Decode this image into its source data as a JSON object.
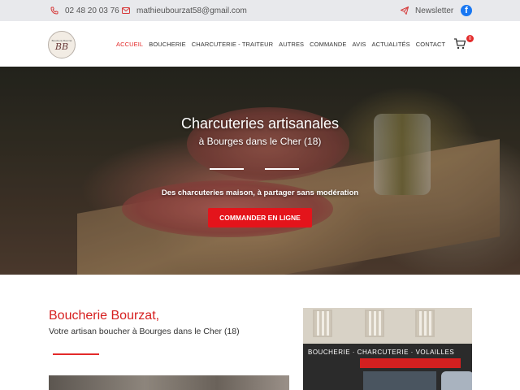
{
  "topbar": {
    "phone": "02 48 20 03 76",
    "email": "mathieubourzat58@gmail.com",
    "newsletter": "Newsletter",
    "facebook_icon": "facebook-icon"
  },
  "header": {
    "logo_text": "BB",
    "logo_caption": "Boucherie Bourzat",
    "nav": [
      {
        "label": "ACCUEIL",
        "active": true
      },
      {
        "label": "BOUCHERIE",
        "active": false
      },
      {
        "label": "CHARCUTERIE - TRAITEUR",
        "active": false
      },
      {
        "label": "AUTRES",
        "active": false
      },
      {
        "label": "COMMANDE",
        "active": false
      },
      {
        "label": "AVIS",
        "active": false
      },
      {
        "label": "ACTUALITÉS",
        "active": false
      },
      {
        "label": "CONTACT",
        "active": false
      }
    ],
    "cart_count": "0"
  },
  "hero": {
    "title": "Charcuteries artisanales",
    "subtitle": "à Bourges dans le Cher (18)",
    "tagline": "Des charcuteries maison, à partager sans modération",
    "cta": "COMMANDER EN LIGNE"
  },
  "intro": {
    "title": "Boucherie Bourzat,",
    "subtitle": "Votre artisan boucher à Bourges dans le Cher (18)"
  },
  "shopfront": {
    "sign": "BOUCHERIE · CHARCUTERIE · VOLAILLES"
  },
  "colors": {
    "accent": "#e32a2a",
    "topbar_bg": "#e8e9ec",
    "cta_bg": "#e4141b"
  }
}
